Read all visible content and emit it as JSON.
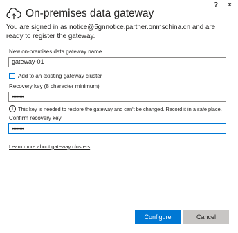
{
  "window": {
    "help_label": "?",
    "close_label": "×"
  },
  "header": {
    "title": "On-premises data gateway",
    "icon": "cloud-upload-icon",
    "subtitle": "You are signed in as notice@5gnnotice.partner.onmschina.cn and are ready to register the gateway."
  },
  "form": {
    "name_label": "New on-premises data gateway name",
    "name_value": "gateway-01",
    "add_cluster_label": "Add to an existing gateway cluster",
    "add_cluster_checked": false,
    "recovery_key_label": "Recovery key (8 character minimum)",
    "recovery_key_value": "••••••••",
    "info_text": "This key is needed to restore the gateway and can't be changed. Record it in a safe place.",
    "confirm_label": "Confirm recovery key",
    "confirm_value": "••••••••",
    "learn_more_link": "Learn more about gateway clusters"
  },
  "buttons": {
    "configure": "Configure",
    "cancel": "Cancel"
  },
  "colors": {
    "accent": "#0078d4",
    "secondary_button": "#c8c6c4"
  }
}
